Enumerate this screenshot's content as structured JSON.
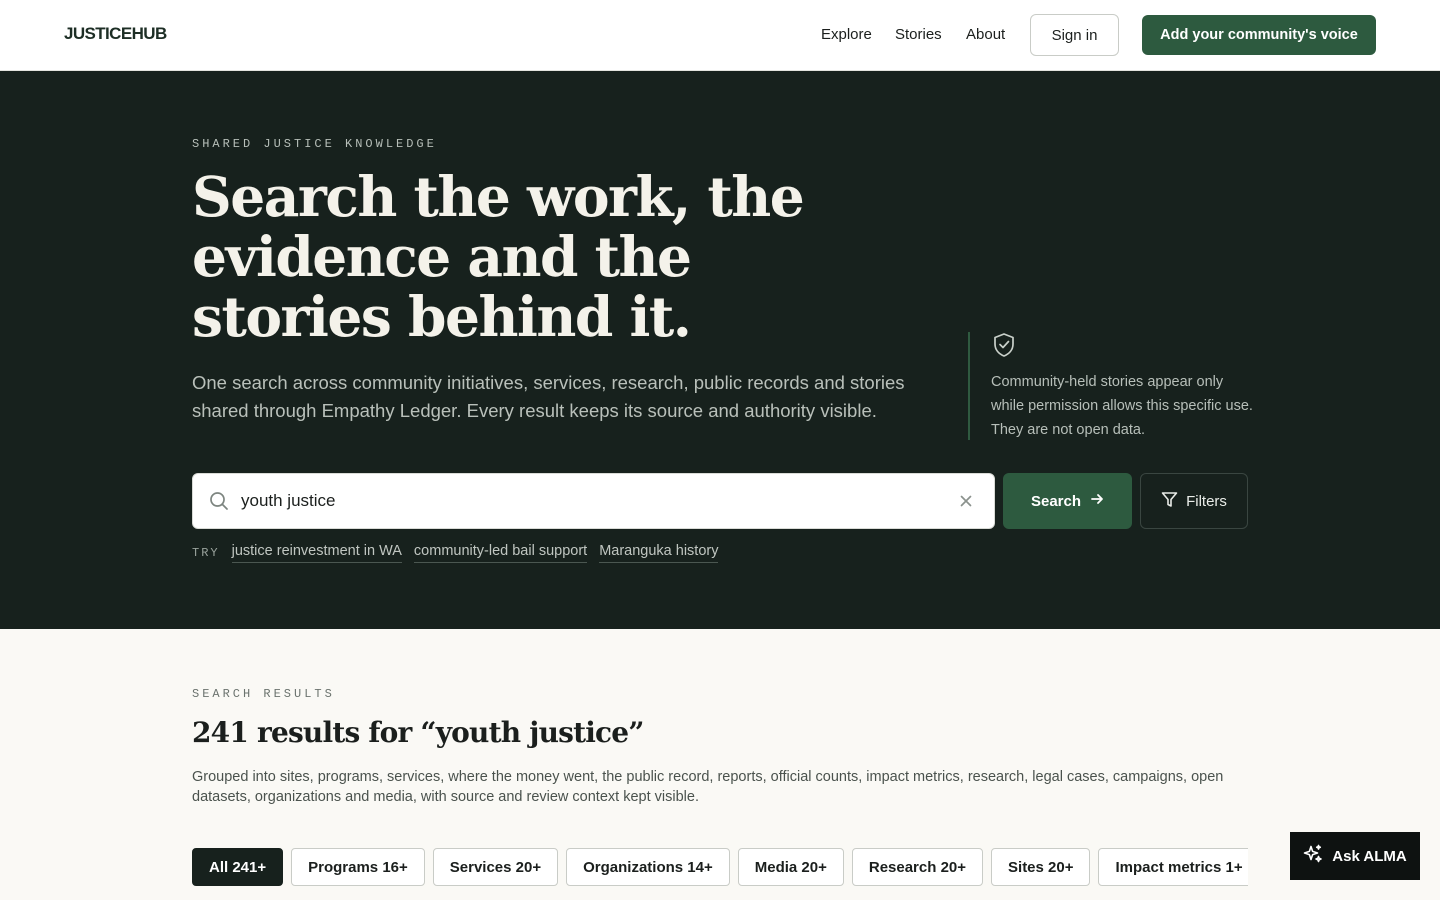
{
  "header": {
    "logo": "JUSTICEHUB",
    "nav": [
      "Explore",
      "Stories",
      "About"
    ],
    "sign_in": "Sign in",
    "add_voice": "Add your community's voice"
  },
  "hero": {
    "eyebrow": "SHARED JUSTICE KNOWLEDGE",
    "title": "Search the work, the evidence and the stories behind it.",
    "lead": "One search across community initiatives, services, research, public records and stories shared through Empathy Ledger. Every result keeps its source and authority visible.",
    "note": "Community-held stories appear only while permission allows this specific use. They are not open data.",
    "note_icon": "shield-check-icon"
  },
  "search": {
    "value": "youth justice",
    "button": "Search",
    "filters": "Filters",
    "try_label": "TRY",
    "suggestions": [
      "justice reinvestment in WA",
      "community-led bail support",
      "Maranguka history"
    ]
  },
  "results": {
    "eyebrow": "SEARCH RESULTS",
    "title": "241 results for “youth justice”",
    "description": "Grouped into sites, programs, services, where the money went, the public record, reports, official counts, impact metrics, research, legal cases, campaigns, open datasets, organizations and media, with source and review context kept visible.",
    "tabs": [
      "All 241+",
      "Programs 16+",
      "Services 20+",
      "Organizations 14+",
      "Media 20+",
      "Research 20+",
      "Sites 20+",
      "Impact metrics 1+",
      ""
    ]
  },
  "assistant": {
    "label": "Ask ALMA"
  },
  "colors": {
    "hero_bg": "#17211d",
    "accent": "#2d5a3f",
    "page_bg": "#faf9f5"
  }
}
